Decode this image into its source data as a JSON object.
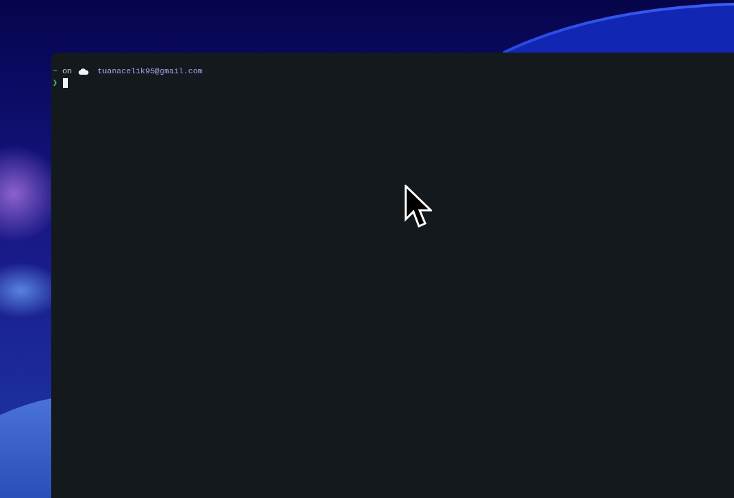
{
  "terminal": {
    "prompt": {
      "directory": "~",
      "connector": "on",
      "account": "tuanacelik95@gmail.com"
    },
    "input_line": {
      "symbol": "❯"
    }
  }
}
